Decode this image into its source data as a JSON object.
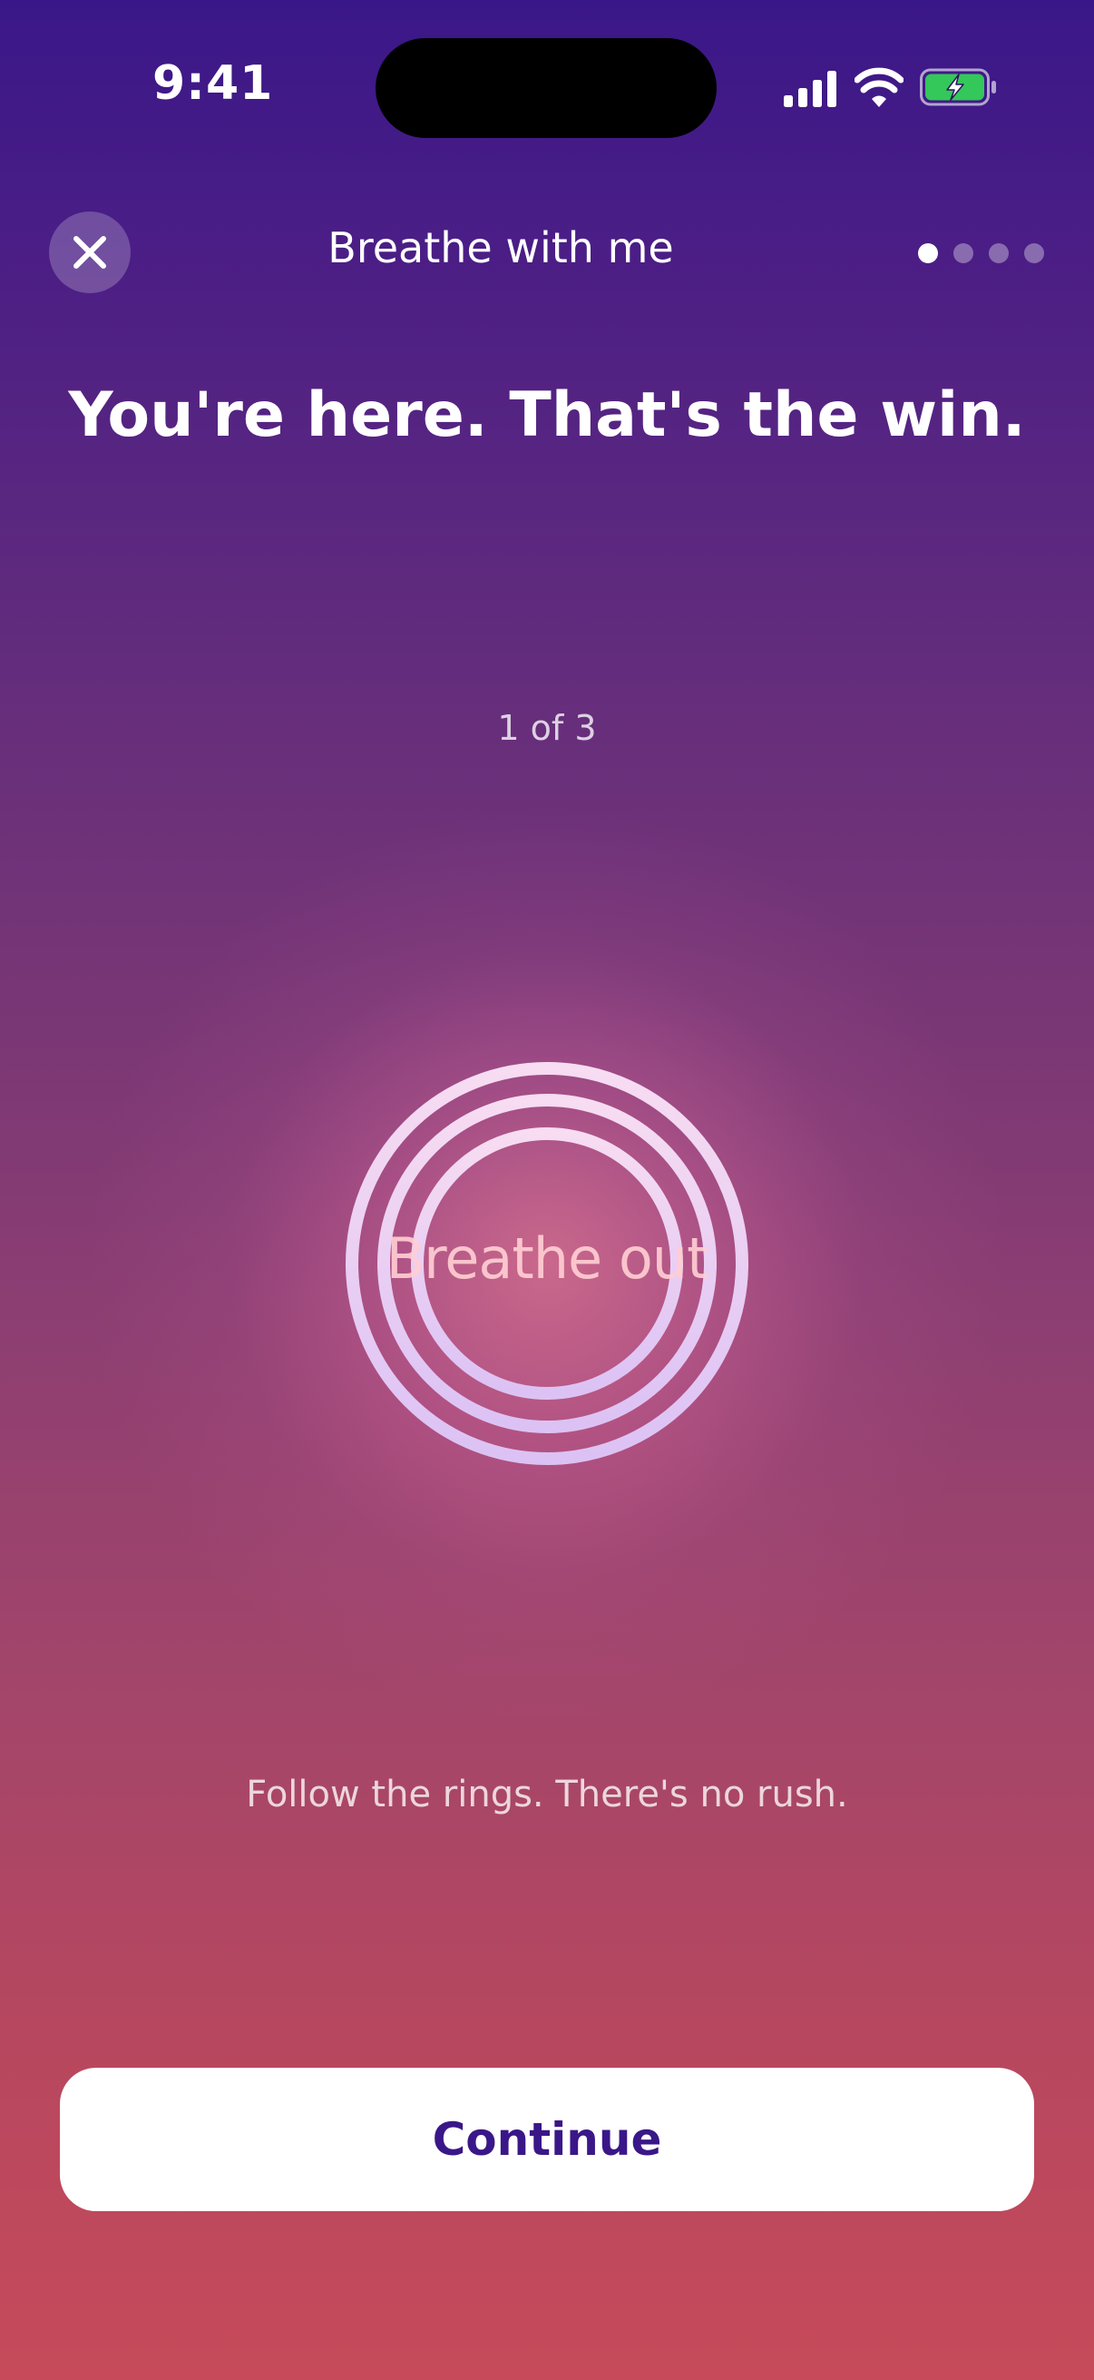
{
  "status_bar": {
    "time": "9:41"
  },
  "header": {
    "close_icon": "close-icon",
    "title": "Breathe with me",
    "pager": {
      "total": 4,
      "active_index": 0
    }
  },
  "main": {
    "headline": "You're here. That's the win.",
    "step_counter": "1 of 3",
    "breathe_label": "Breathe out",
    "hint": "Follow the rings. There's no rush."
  },
  "footer": {
    "continue_label": "Continue"
  },
  "colors": {
    "gradient_top": "#3a1788",
    "gradient_bottom": "#c64a5a",
    "button_text": "#3a1788",
    "ring": "#f2d7f4",
    "battery_fill": "#34c759"
  }
}
